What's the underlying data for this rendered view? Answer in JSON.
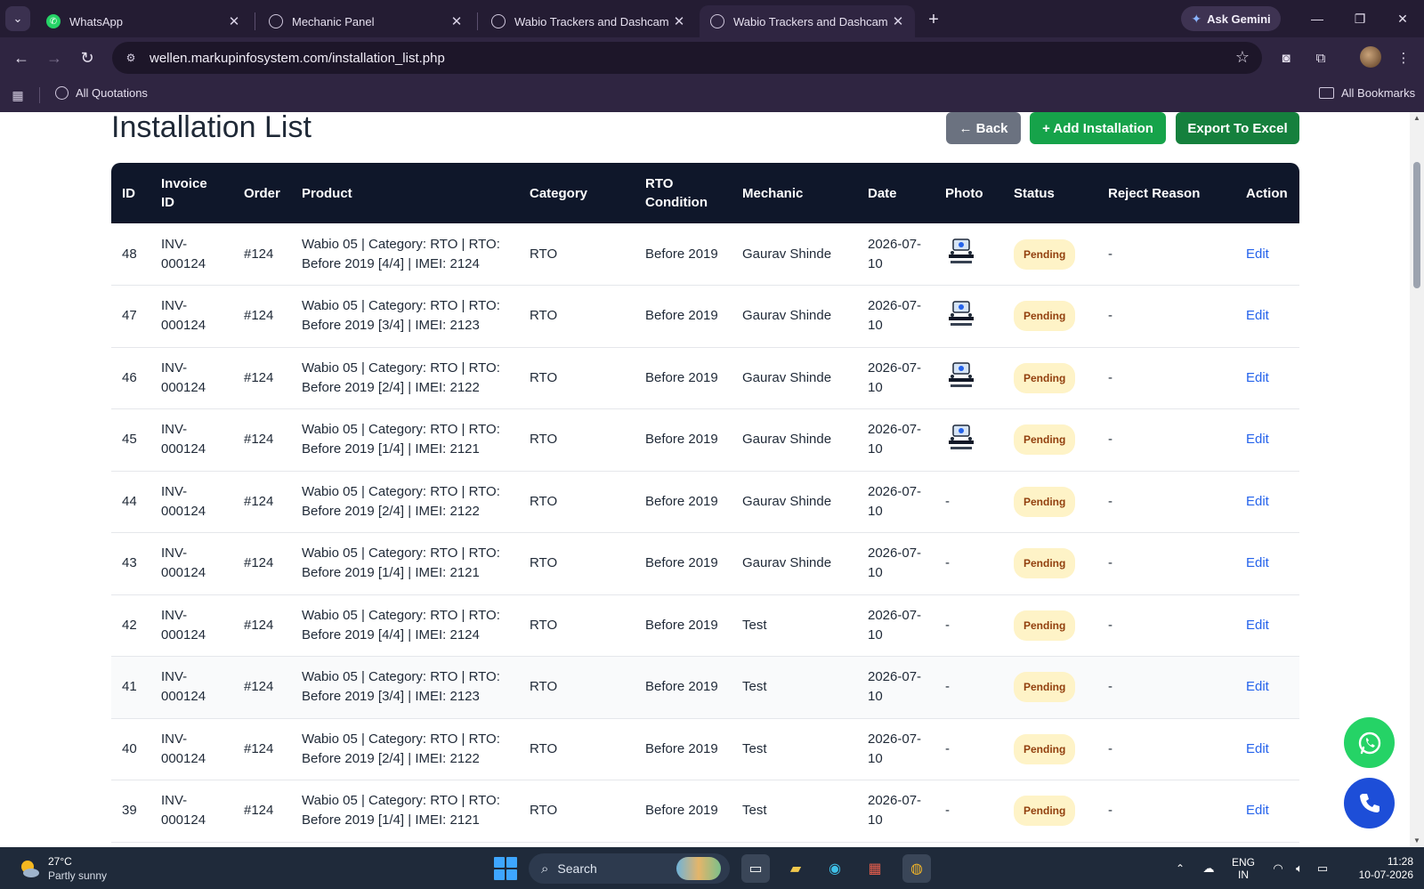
{
  "browser": {
    "tabs": [
      {
        "title": "WhatsApp",
        "icon": "whatsapp-icon"
      },
      {
        "title": "Mechanic Panel",
        "icon": "globe-icon"
      },
      {
        "title": "Wabio Trackers and Dashcams",
        "icon": "globe-icon"
      },
      {
        "title": "Wabio Trackers and Dashcams",
        "icon": "globe-icon",
        "active": true
      }
    ],
    "gemini_label": "Ask Gemini",
    "url": "wellen.markupinfosystem.com/installation_list.php",
    "bookmarks": {
      "item": "All Quotations",
      "all": "All Bookmarks"
    }
  },
  "page": {
    "title": "Installation List",
    "buttons": {
      "back": "← Back",
      "add": "+ Add Installation",
      "export": "Export To Excel"
    },
    "colors": {
      "header_bg": "#0f172a",
      "add_btn": "#16a34a",
      "export_btn": "#15803d",
      "back_btn": "#6b7280",
      "badge_bg": "#fef3c7",
      "badge_text": "#92400e",
      "link": "#2563eb"
    }
  },
  "table": {
    "headers": [
      "ID",
      "Invoice ID",
      "Order",
      "Product",
      "Category",
      "RTO Condition",
      "Mechanic",
      "Date",
      "Photo",
      "Status",
      "Reject Reason",
      "Action"
    ],
    "rows": [
      {
        "id": "48",
        "invoice": "INV-000124",
        "order": "#124",
        "product": "Wabio 05 | Category: RTO | RTO: Before 2019 [4/4] | IMEI: 2124",
        "category": "RTO",
        "rto": "Before 2019",
        "mechanic": "Gaurav Shinde",
        "date": "2026-07-10",
        "photo": true,
        "photo_text": "",
        "status": "Pending",
        "reject": "-",
        "action": "Edit"
      },
      {
        "id": "47",
        "invoice": "INV-000124",
        "order": "#124",
        "product": "Wabio 05 | Category: RTO | RTO: Before 2019 [3/4] | IMEI: 2123",
        "category": "RTO",
        "rto": "Before 2019",
        "mechanic": "Gaurav Shinde",
        "date": "2026-07-10",
        "photo": true,
        "photo_text": "",
        "status": "Pending",
        "reject": "-",
        "action": "Edit"
      },
      {
        "id": "46",
        "invoice": "INV-000124",
        "order": "#124",
        "product": "Wabio 05 | Category: RTO | RTO: Before 2019 [2/4] | IMEI: 2122",
        "category": "RTO",
        "rto": "Before 2019",
        "mechanic": "Gaurav Shinde",
        "date": "2026-07-10",
        "photo": true,
        "photo_text": "",
        "status": "Pending",
        "reject": "-",
        "action": "Edit"
      },
      {
        "id": "45",
        "invoice": "INV-000124",
        "order": "#124",
        "product": "Wabio 05 | Category: RTO | RTO: Before 2019 [1/4] | IMEI: 2121",
        "category": "RTO",
        "rto": "Before 2019",
        "mechanic": "Gaurav Shinde",
        "date": "2026-07-10",
        "photo": true,
        "photo_text": "",
        "status": "Pending",
        "reject": "-",
        "action": "Edit"
      },
      {
        "id": "44",
        "invoice": "INV-000124",
        "order": "#124",
        "product": "Wabio 05 | Category: RTO | RTO: Before 2019 [2/4] | IMEI: 2122",
        "category": "RTO",
        "rto": "Before 2019",
        "mechanic": "Gaurav Shinde",
        "date": "2026-07-10",
        "photo": false,
        "photo_text": "-",
        "status": "Pending",
        "reject": "-",
        "action": "Edit"
      },
      {
        "id": "43",
        "invoice": "INV-000124",
        "order": "#124",
        "product": "Wabio 05 | Category: RTO | RTO: Before 2019 [1/4] | IMEI: 2121",
        "category": "RTO",
        "rto": "Before 2019",
        "mechanic": "Gaurav Shinde",
        "date": "2026-07-10",
        "photo": false,
        "photo_text": "-",
        "status": "Pending",
        "reject": "-",
        "action": "Edit"
      },
      {
        "id": "42",
        "invoice": "INV-000124",
        "order": "#124",
        "product": "Wabio 05 | Category: RTO | RTO: Before 2019 [4/4] | IMEI: 2124",
        "category": "RTO",
        "rto": "Before 2019",
        "mechanic": "Test",
        "date": "2026-07-10",
        "photo": false,
        "photo_text": "-",
        "status": "Pending",
        "reject": "-",
        "action": "Edit"
      },
      {
        "id": "41",
        "invoice": "INV-000124",
        "order": "#124",
        "product": "Wabio 05 | Category: RTO | RTO: Before 2019 [3/4] | IMEI: 2123",
        "category": "RTO",
        "rto": "Before 2019",
        "mechanic": "Test",
        "date": "2026-07-10",
        "photo": false,
        "photo_text": "-",
        "status": "Pending",
        "reject": "-",
        "action": "Edit"
      },
      {
        "id": "40",
        "invoice": "INV-000124",
        "order": "#124",
        "product": "Wabio 05 | Category: RTO | RTO: Before 2019 [2/4] | IMEI: 2122",
        "category": "RTO",
        "rto": "Before 2019",
        "mechanic": "Test",
        "date": "2026-07-10",
        "photo": false,
        "photo_text": "-",
        "status": "Pending",
        "reject": "-",
        "action": "Edit"
      },
      {
        "id": "39",
        "invoice": "INV-000124",
        "order": "#124",
        "product": "Wabio 05 | Category: RTO | RTO: Before 2019 [1/4] | IMEI: 2121",
        "category": "RTO",
        "rto": "Before 2019",
        "mechanic": "Test",
        "date": "2026-07-10",
        "photo": false,
        "photo_text": "-",
        "status": "Pending",
        "reject": "-",
        "action": "Edit"
      }
    ]
  },
  "taskbar": {
    "weather": {
      "temp": "27°C",
      "condition": "Partly sunny"
    },
    "search": "Search",
    "lang": [
      "ENG",
      "IN"
    ],
    "time": "11:28",
    "date": "10-07-2026"
  }
}
